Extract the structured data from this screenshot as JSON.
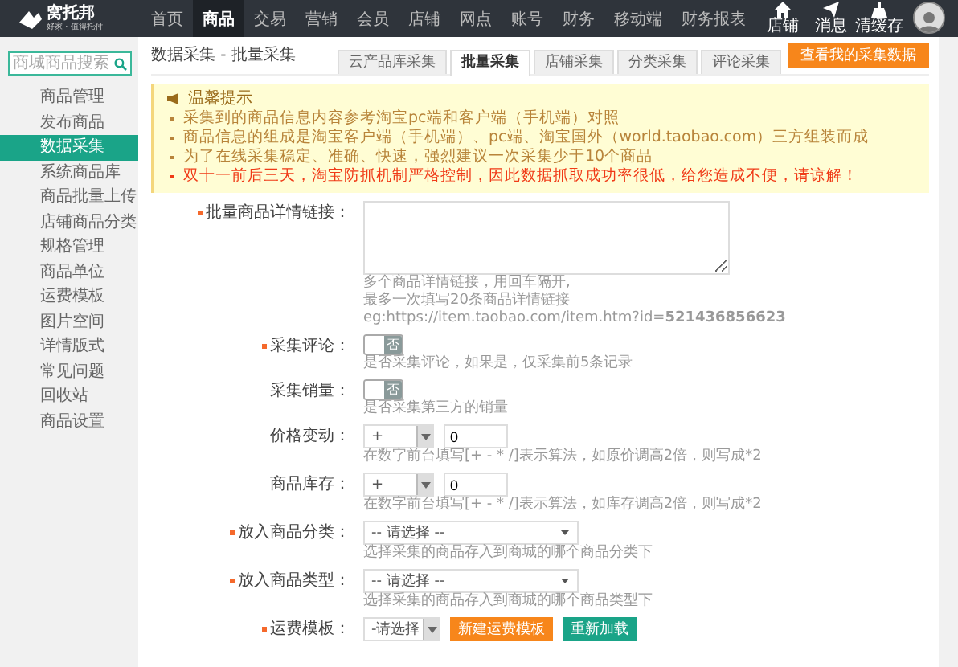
{
  "header": {
    "logo": {
      "name": "窝托邦",
      "tagline": "好家 · 值得托付"
    },
    "menu": [
      {
        "label": "首页",
        "selected": false
      },
      {
        "label": "商品",
        "selected": true
      },
      {
        "label": "交易",
        "selected": false
      },
      {
        "label": "营销",
        "selected": false
      },
      {
        "label": "会员",
        "selected": false
      },
      {
        "label": "店铺",
        "selected": false
      },
      {
        "label": "网点",
        "selected": false
      },
      {
        "label": "账号",
        "selected": false
      },
      {
        "label": "财务",
        "selected": false
      },
      {
        "label": "移动端",
        "selected": false
      },
      {
        "label": "财务报表",
        "selected": false
      }
    ],
    "actions": [
      {
        "kind": "store",
        "label": "店铺"
      },
      {
        "kind": "message",
        "label": "消息"
      },
      {
        "kind": "clear",
        "label": "清缓存"
      }
    ]
  },
  "sidebar": {
    "search": {
      "placeholder": "商城商品搜索"
    },
    "items": [
      {
        "label": "商品管理",
        "selected": false
      },
      {
        "label": "发布商品",
        "selected": false
      },
      {
        "label": "数据采集",
        "selected": true
      },
      {
        "label": "系统商品库",
        "selected": false
      },
      {
        "label": "商品批量上传",
        "selected": false
      },
      {
        "label": "店铺商品分类",
        "selected": false
      },
      {
        "label": "规格管理",
        "selected": false
      },
      {
        "label": "商品单位",
        "selected": false
      },
      {
        "label": "运费模板",
        "selected": false
      },
      {
        "label": "图片空间",
        "selected": false
      },
      {
        "label": "详情版式",
        "selected": false
      },
      {
        "label": "常见问题",
        "selected": false
      },
      {
        "label": "回收站",
        "selected": false
      },
      {
        "label": "商品设置",
        "selected": false
      }
    ]
  },
  "page": {
    "title": "数据采集 - 批量采集",
    "tabs": [
      {
        "label": "云产品库采集",
        "selected": false
      },
      {
        "label": "批量采集",
        "selected": true
      },
      {
        "label": "店铺采集",
        "selected": false
      },
      {
        "label": "分类采集",
        "selected": false
      },
      {
        "label": "评论采集",
        "selected": false
      }
    ],
    "action_button": "查看我的采集数据"
  },
  "notice": {
    "title": "温馨提示",
    "items": [
      {
        "text": "采集到的商品信息内容参考淘宝pc端和客户端（手机端）对照",
        "highlight": false
      },
      {
        "text": "商品信息的组成是淘宝客户端（手机端）、pc端、淘宝国外（world.taobao.com）三方组装而成",
        "highlight": false
      },
      {
        "text": "为了在线采集稳定、准确、快速，强烈建议一次采集少于10个商品",
        "highlight": false
      },
      {
        "text": "双十一前后三天，淘宝防抓机制严格控制，因此数据抓取成功率很低，给您造成不便，请谅解！",
        "highlight": true
      }
    ]
  },
  "form": [
    {
      "kind": "textarea",
      "label": "批量商品详情链接：",
      "required": true,
      "hints": [
        "多个商品详情链接，用回车隔开,",
        "最多一次填写20条商品详情链接",
        "eg:https://item.taobao.com/item.htm?id=**521436856623**"
      ]
    },
    {
      "kind": "toggle",
      "label": "采集评论：",
      "required": true,
      "on": false,
      "off_label": "否",
      "hints": [
        "是否采集评论，如果是，仅采集前5条记录"
      ]
    },
    {
      "kind": "toggle",
      "label": "采集销量：",
      "required": false,
      "on": false,
      "off_label": "否",
      "hints": [
        "是否采集第三方的销量"
      ]
    },
    {
      "kind": "adjust",
      "label": "价格变动：",
      "required": false,
      "operator": "+",
      "value": "0",
      "hints": [
        "在数字前台填写[+ - * /]表示算法，如原价调高2倍，则写成*2"
      ]
    },
    {
      "kind": "adjust",
      "label": "商品库存：",
      "required": false,
      "operator": "+",
      "value": "0",
      "hints": [
        "在数字前台填写[+ - * /]表示算法，如库存调高2倍，则写成*2"
      ]
    },
    {
      "kind": "select",
      "label": "放入商品分类：",
      "required": true,
      "placeholder": "-- 请选择 --",
      "hints": [
        "选择采集的商品存入到商城的哪个商品分类下"
      ]
    },
    {
      "kind": "select",
      "label": "放入商品类型：",
      "required": true,
      "placeholder": "-- 请选择 --",
      "hints": [
        "选择采集的商品存入到商城的哪个商品类型下"
      ]
    },
    {
      "kind": "freight",
      "label": "运费模板：",
      "required": true,
      "placeholder": "-请选择",
      "buttons": [
        {
          "label": "新建运费模板",
          "kind": "create"
        },
        {
          "label": "重新加载",
          "kind": "reload"
        }
      ]
    }
  ]
}
